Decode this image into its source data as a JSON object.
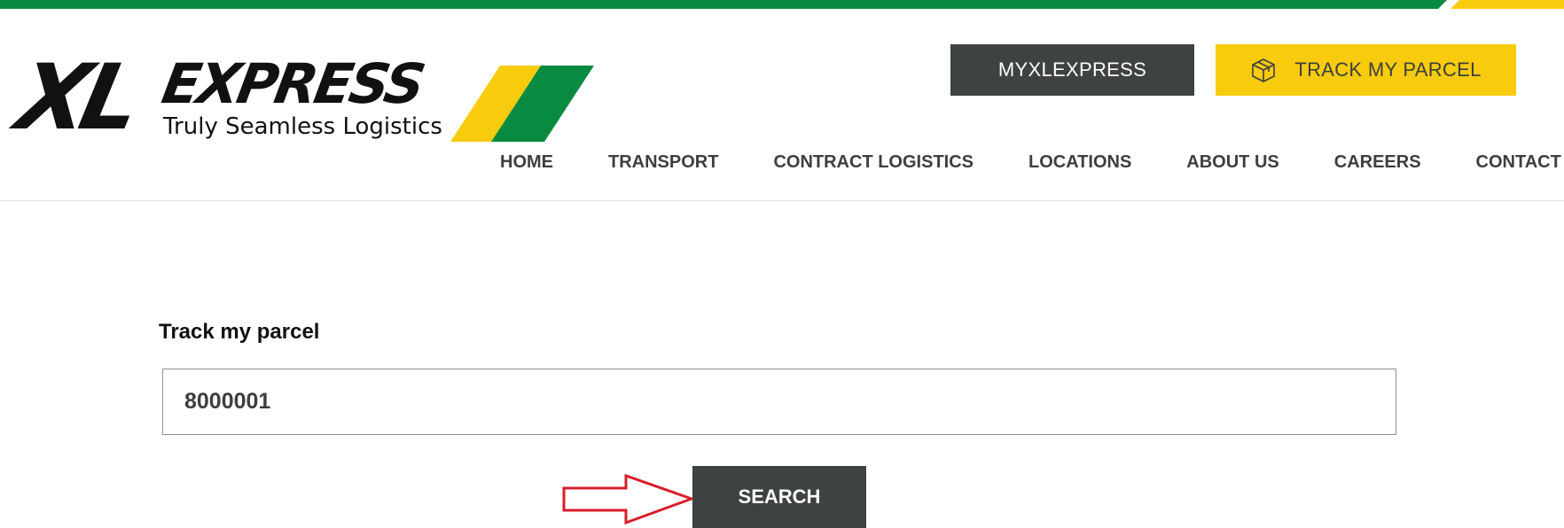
{
  "colors": {
    "green": "#088a41",
    "yellow": "#f8cb0c",
    "dark": "#3e4241",
    "annotation_red": "#d81e28"
  },
  "logo": {
    "mark": "XL",
    "wordmark": "EXPRESS",
    "tagline": "Truly Seamless Logistics"
  },
  "header": {
    "myxlexpress_label": "MYXLEXPRESS",
    "track_label": "TRACK MY PARCEL",
    "track_icon": "parcel-box-icon"
  },
  "nav": {
    "items": [
      {
        "label": "HOME"
      },
      {
        "label": "TRANSPORT"
      },
      {
        "label": "CONTRACT LOGISTICS"
      },
      {
        "label": "LOCATIONS"
      },
      {
        "label": "ABOUT US"
      },
      {
        "label": "CAREERS"
      },
      {
        "label": "CONTACT"
      }
    ]
  },
  "main": {
    "title": "Track my parcel",
    "input_value": "8000001",
    "search_label": "SEARCH"
  }
}
